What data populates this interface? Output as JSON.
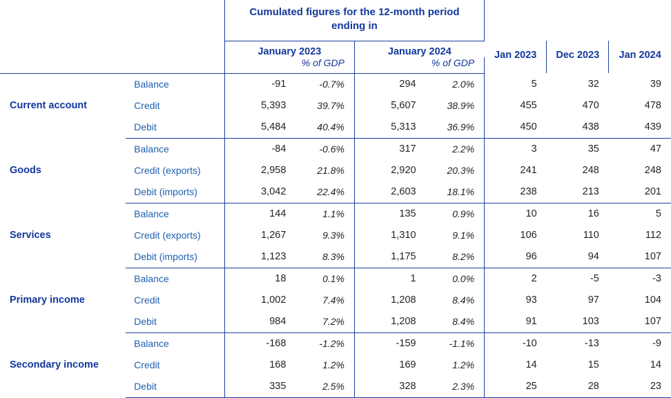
{
  "header": {
    "cumulated_title": "Cumulated figures for the 12-month period ending in",
    "period_1": "January 2023",
    "period_2": "January 2024",
    "pct_label_1": "% of GDP",
    "pct_label_2": "% of GDP",
    "month_1": "Jan 2023",
    "month_2": "Dec 2023",
    "month_3": "Jan 2024"
  },
  "colors": {
    "navy": "#13389c",
    "item_blue": "#1e5fae",
    "rule": "#1b3f9e",
    "value_ink": "#231f20"
  },
  "sections": [
    {
      "name": "Current account",
      "rows": [
        {
          "label": "Balance",
          "cum_2023": "-91",
          "pct_2023": "-0.7%",
          "cum_2024": "294",
          "pct_2024": "2.0%",
          "m1": "5",
          "m2": "32",
          "m3": "39"
        },
        {
          "label": "Credit",
          "cum_2023": "5,393",
          "pct_2023": "39.7%",
          "cum_2024": "5,607",
          "pct_2024": "38.9%",
          "m1": "455",
          "m2": "470",
          "m3": "478"
        },
        {
          "label": "Debit",
          "cum_2023": "5,484",
          "pct_2023": "40.4%",
          "cum_2024": "5,313",
          "pct_2024": "36.9%",
          "m1": "450",
          "m2": "438",
          "m3": "439"
        }
      ]
    },
    {
      "name": "Goods",
      "rows": [
        {
          "label": "Balance",
          "cum_2023": "-84",
          "pct_2023": "-0.6%",
          "cum_2024": "317",
          "pct_2024": "2.2%",
          "m1": "3",
          "m2": "35",
          "m3": "47"
        },
        {
          "label": "Credit (exports)",
          "cum_2023": "2,958",
          "pct_2023": "21.8%",
          "cum_2024": "2,920",
          "pct_2024": "20.3%",
          "m1": "241",
          "m2": "248",
          "m3": "248"
        },
        {
          "label": "Debit (imports)",
          "cum_2023": "3,042",
          "pct_2023": "22.4%",
          "cum_2024": "2,603",
          "pct_2024": "18.1%",
          "m1": "238",
          "m2": "213",
          "m3": "201"
        }
      ]
    },
    {
      "name": "Services",
      "rows": [
        {
          "label": "Balance",
          "cum_2023": "144",
          "pct_2023": "1.1%",
          "cum_2024": "135",
          "pct_2024": "0.9%",
          "m1": "10",
          "m2": "16",
          "m3": "5"
        },
        {
          "label": "Credit (exports)",
          "cum_2023": "1,267",
          "pct_2023": "9.3%",
          "cum_2024": "1,310",
          "pct_2024": "9.1%",
          "m1": "106",
          "m2": "110",
          "m3": "112"
        },
        {
          "label": "Debit (imports)",
          "cum_2023": "1,123",
          "pct_2023": "8.3%",
          "cum_2024": "1,175",
          "pct_2024": "8.2%",
          "m1": "96",
          "m2": "94",
          "m3": "107"
        }
      ]
    },
    {
      "name": "Primary income",
      "rows": [
        {
          "label": "Balance",
          "cum_2023": "18",
          "pct_2023": "0.1%",
          "cum_2024": "1",
          "pct_2024": "0.0%",
          "m1": "2",
          "m2": "-5",
          "m3": "-3"
        },
        {
          "label": "Credit",
          "cum_2023": "1,002",
          "pct_2023": "7.4%",
          "cum_2024": "1,208",
          "pct_2024": "8.4%",
          "m1": "93",
          "m2": "97",
          "m3": "104"
        },
        {
          "label": "Debit",
          "cum_2023": "984",
          "pct_2023": "7.2%",
          "cum_2024": "1,208",
          "pct_2024": "8.4%",
          "m1": "91",
          "m2": "103",
          "m3": "107"
        }
      ]
    },
    {
      "name": "Secondary income",
      "rows": [
        {
          "label": "Balance",
          "cum_2023": "-168",
          "pct_2023": "-1.2%",
          "cum_2024": "-159",
          "pct_2024": "-1.1%",
          "m1": "-10",
          "m2": "-13",
          "m3": "-9"
        },
        {
          "label": "Credit",
          "cum_2023": "168",
          "pct_2023": "1.2%",
          "cum_2024": "169",
          "pct_2024": "1.2%",
          "m1": "14",
          "m2": "15",
          "m3": "14"
        },
        {
          "label": "Debit",
          "cum_2023": "335",
          "pct_2023": "2.5%",
          "cum_2024": "328",
          "pct_2024": "2.3%",
          "m1": "25",
          "m2": "28",
          "m3": "23"
        }
      ]
    }
  ]
}
